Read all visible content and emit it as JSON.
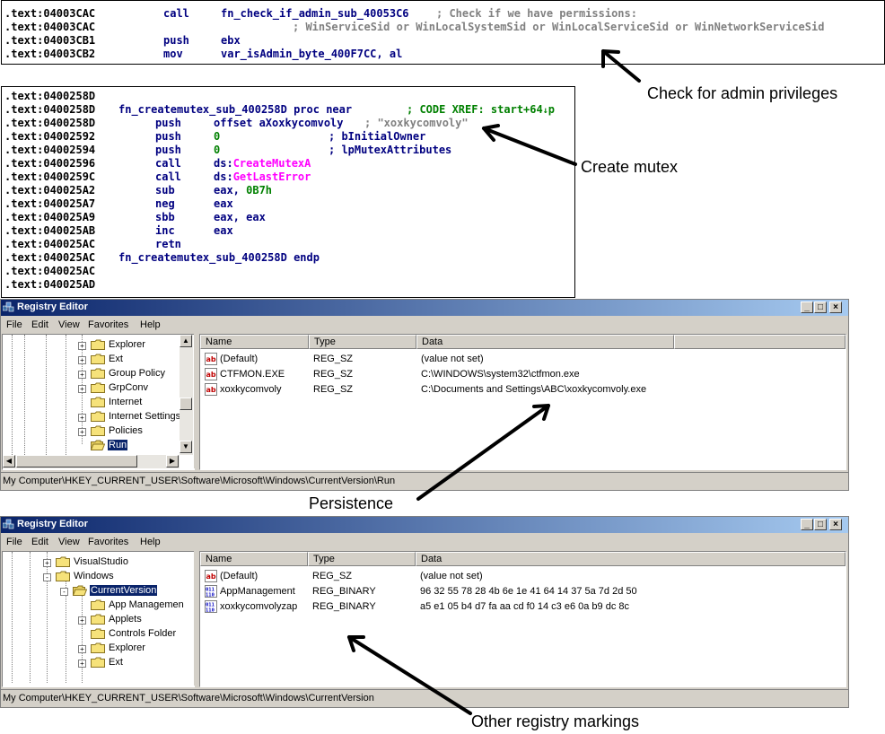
{
  "code_block_1": {
    "lines": [
      {
        "addr": ".text:04003CAC",
        "mnem": "call",
        "operand": "fn_check_if_admin_sub_40053C6",
        "comment": "; Check if we have permissions:"
      },
      {
        "addr": ".text:04003CAC",
        "mnem": "",
        "operand": "",
        "comment": "; WinServiceSid or WinLocalSystemSid or WinLocalServiceSid or WinNetworkServiceSid"
      },
      {
        "addr": ".text:04003CB1",
        "mnem": "push",
        "operand": "ebx",
        "comment": ""
      },
      {
        "addr": ".text:04003CB2",
        "mnem": "mov",
        "operand": "var_isAdmin_byte_400F7CC, al",
        "comment": ""
      }
    ]
  },
  "code_block_2": {
    "addresses": [
      ".text:0400258D",
      ".text:0400258D",
      ".text:0400258D",
      ".text:04002592",
      ".text:04002594",
      ".text:04002596",
      ".text:0400259C",
      ".text:040025A2",
      ".text:040025A7",
      ".text:040025A9",
      ".text:040025AB",
      ".text:040025AC",
      ".text:040025AC",
      ".text:040025AC",
      ".text:040025AD"
    ],
    "proc_line": "fn_createmutex_sub_400258D proc near",
    "xref": "; CODE XREF: start+64",
    "xref_suffix": "p",
    "l3_mnem": "push",
    "l3_op": "offset aXoxkycomvoly",
    "l3_str": "; \"xoxkycomvoly\"",
    "l4_mnem": "push",
    "l4_op": "0",
    "l4_cm": "; bInitialOwner",
    "l5_mnem": "push",
    "l5_op": "0",
    "l5_cm": "; lpMutexAttributes",
    "l6_mnem": "call",
    "l6_seg": "ds:",
    "l6_fn": "CreateMutexA",
    "l7_mnem": "call",
    "l7_seg": "ds:",
    "l7_fn": "GetLastError",
    "l8_mnem": "sub",
    "l8_op": "eax, ",
    "l8_num": "0B7h",
    "l9_mnem": "neg",
    "l9_op": "eax",
    "l10_mnem": "sbb",
    "l10_op": "eax, eax",
    "l11_mnem": "inc",
    "l11_op": "eax",
    "l12_mnem": "retn",
    "endp_line": "fn_createmutex_sub_400258D endp"
  },
  "captions": {
    "admin": "Check for admin privileges",
    "mutex": "Create mutex",
    "persistence": "Persistence",
    "other": "Other registry markings"
  },
  "reg1": {
    "title": "Registry Editor",
    "menu": [
      "File",
      "Edit",
      "View",
      "Favorites",
      "Help"
    ],
    "tree": [
      {
        "label": "Explorer",
        "expander": "+"
      },
      {
        "label": "Ext",
        "expander": "+"
      },
      {
        "label": "Group Policy",
        "expander": "+"
      },
      {
        "label": "GrpConv",
        "expander": "+"
      },
      {
        "label": "Internet",
        "expander": ""
      },
      {
        "label": "Internet Settings",
        "expander": "+"
      },
      {
        "label": "Policies",
        "expander": "+"
      },
      {
        "label": "Run",
        "expander": ""
      }
    ],
    "columns": [
      "Name",
      "Type",
      "Data"
    ],
    "rows": [
      {
        "name": "(Default)",
        "type": "REG_SZ",
        "data": "(value not set)",
        "icon": "string"
      },
      {
        "name": "CTFMON.EXE",
        "type": "REG_SZ",
        "data": "C:\\WINDOWS\\system32\\ctfmon.exe",
        "icon": "string"
      },
      {
        "name": "xoxkycomvoly",
        "type": "REG_SZ",
        "data": "C:\\Documents and Settings\\ABC\\xoxkycomvoly.exe",
        "icon": "string"
      }
    ],
    "status": "My Computer\\HKEY_CURRENT_USER\\Software\\Microsoft\\Windows\\CurrentVersion\\Run"
  },
  "reg2": {
    "title": "Registry Editor",
    "menu": [
      "File",
      "Edit",
      "View",
      "Favorites",
      "Help"
    ],
    "tree": [
      {
        "label": "VisualStudio",
        "expander": "+"
      },
      {
        "label": "Windows",
        "expander": "-"
      },
      {
        "label": "CurrentVersion",
        "expander": "-"
      },
      {
        "label": "App Managemen",
        "expander": ""
      },
      {
        "label": "Applets",
        "expander": "+"
      },
      {
        "label": "Controls Folder",
        "expander": ""
      },
      {
        "label": "Explorer",
        "expander": "+"
      },
      {
        "label": "Ext",
        "expander": "+"
      }
    ],
    "columns": [
      "Name",
      "Type",
      "Data"
    ],
    "rows": [
      {
        "name": "(Default)",
        "type": "REG_SZ",
        "data": "(value not set)",
        "icon": "string"
      },
      {
        "name": "AppManagement",
        "type": "REG_BINARY",
        "data": "96 32 55 78 28 4b 6e 1e 41 64 14 37 5a 7d 2d 50",
        "icon": "binary"
      },
      {
        "name": "xoxkycomvolyzap",
        "type": "REG_BINARY",
        "data": "a5 e1 05 b4 d7 fa aa cd f0 14 c3 e6 0a b9 dc 8c",
        "icon": "binary"
      }
    ],
    "status": "My Computer\\HKEY_CURRENT_USER\\Software\\Microsoft\\Windows\\CurrentVersion"
  },
  "colors": {
    "code_blue": "#000080",
    "code_green": "#008000",
    "code_pink": "#ff00ff",
    "title_start": "#0a246a",
    "title_end": "#a6caf0"
  }
}
